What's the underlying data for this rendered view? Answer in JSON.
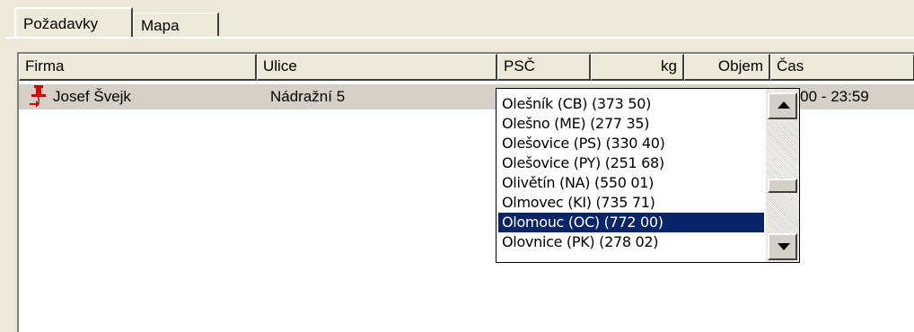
{
  "tabs": [
    {
      "label": "Požadavky",
      "active": true
    },
    {
      "label": "Mapa",
      "active": false
    }
  ],
  "table": {
    "columns": [
      "Firma",
      "Ulice",
      "PSČ",
      "kg",
      "Objem",
      "Čas"
    ],
    "rows": [
      {
        "firma": "Josef Švejk",
        "ulice": "Nádražní 5",
        "cas": "0:00 - 23:59",
        "icon": "pushpin-icon"
      }
    ]
  },
  "dropdown": {
    "items": [
      "Olešník  (CB) (373 50)",
      "Olešno  (ME) (277 35)",
      "Olešovice  (PS) (330 40)",
      "Olešovice  (PY) (251 68)",
      "Olivětín  (NA) (550 01)",
      "Olmovec  (KI) (735 71)",
      "Olomouc  (OC) (772 00)",
      "Olovnice  (PK) (278 02)"
    ],
    "selected_index": 6
  },
  "colors": {
    "selection": "#0a246a",
    "row_highlight": "#d4d0c8",
    "pin": "#d00000"
  }
}
